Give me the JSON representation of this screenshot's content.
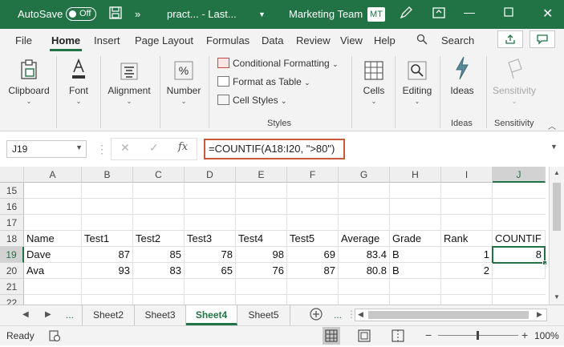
{
  "titlebar": {
    "autosave": "AutoSave",
    "autosave_state": "Off",
    "overflow": "»",
    "filename": "pract...  -  Last...",
    "team": "Marketing Team",
    "initials": "MT"
  },
  "tabs": [
    "File",
    "Home",
    "Insert",
    "Page Layout",
    "Formulas",
    "Data",
    "Review",
    "View",
    "Help",
    "Search"
  ],
  "ribbon": {
    "clipboard": "Clipboard",
    "font": "Font",
    "alignment": "Alignment",
    "number": "Number",
    "conditional_formatting": "Conditional Formatting",
    "format_as_table": "Format as Table",
    "cell_styles": "Cell Styles",
    "styles_group": "Styles",
    "cells": "Cells",
    "editing": "Editing",
    "ideas": "Ideas",
    "ideas_group": "Ideas",
    "sensitivity": "Sensitivity",
    "sensitivity_group": "Sensitivity"
  },
  "formula_bar": {
    "name_box": "J19",
    "fx": "fx",
    "formula": "=COUNTIF(A18:I20, \">80\")"
  },
  "grid": {
    "columns": [
      "A",
      "B",
      "C",
      "D",
      "E",
      "F",
      "G",
      "H",
      "I",
      "J"
    ],
    "rows": [
      "15",
      "16",
      "17",
      "18",
      "19",
      "20",
      "21",
      "22"
    ],
    "row18": [
      "Name",
      "Test1",
      "Test2",
      "Test3",
      "Test4",
      "Test5",
      "Average",
      "Grade",
      "Rank",
      "COUNTIF"
    ],
    "row19": [
      "Dave",
      "87",
      "85",
      "78",
      "98",
      "69",
      "83.4",
      "B",
      "1",
      "8"
    ],
    "row20": [
      "Ava",
      "93",
      "83",
      "65",
      "76",
      "87",
      "80.8",
      "B",
      "2",
      ""
    ]
  },
  "sheet_tabs": {
    "more": "...",
    "tabs": [
      "Sheet2",
      "Sheet3",
      "Sheet4",
      "Sheet5"
    ],
    "more_right": "..."
  },
  "status": {
    "ready": "Ready",
    "zoom": "100%"
  }
}
